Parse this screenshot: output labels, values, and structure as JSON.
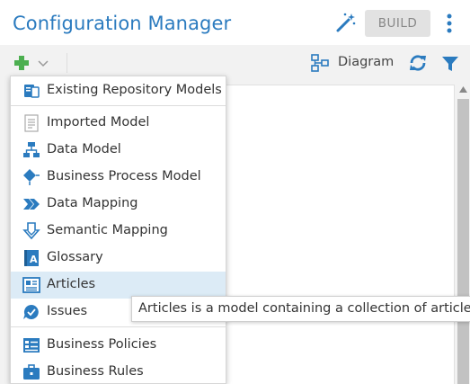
{
  "header": {
    "title": "Configuration Manager",
    "build_label": "BUILD",
    "icons": [
      "magic-wand-icon",
      "kebab-menu-icon"
    ]
  },
  "toolbar": {
    "add_icon": "plus-icon",
    "diagram_label": "Diagram",
    "icons": [
      "diagram-icon",
      "refresh-icon",
      "filter-icon"
    ]
  },
  "menu": {
    "items": [
      {
        "label": "Existing Repository Models",
        "icon": "repository-models-icon"
      },
      {
        "label": "Imported Model",
        "icon": "imported-model-icon"
      },
      {
        "label": "Data Model",
        "icon": "data-model-icon"
      },
      {
        "label": "Business Process Model",
        "icon": "business-process-icon"
      },
      {
        "label": "Data Mapping",
        "icon": "data-mapping-icon"
      },
      {
        "label": "Semantic Mapping",
        "icon": "semantic-mapping-icon"
      },
      {
        "label": "Glossary",
        "icon": "glossary-icon"
      },
      {
        "label": "Articles",
        "icon": "articles-icon",
        "highlighted": true
      },
      {
        "label": "Issues",
        "icon": "issues-icon"
      },
      {
        "label": "Business Policies",
        "icon": "business-policies-icon"
      },
      {
        "label": "Business Rules",
        "icon": "business-rules-icon"
      }
    ]
  },
  "tooltip": {
    "text": "Articles is a model containing a collection of articles."
  },
  "colors": {
    "accent": "#2b7bbf",
    "green": "#4caf50",
    "highlight": "#dcebf6"
  }
}
